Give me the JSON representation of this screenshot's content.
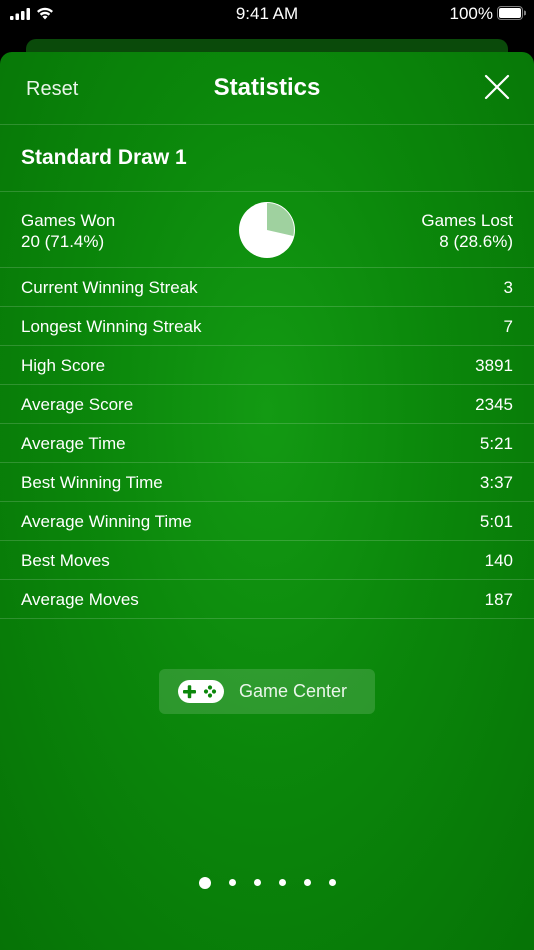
{
  "status_bar": {
    "time": "9:41 AM",
    "battery_percent": "100%",
    "icons": [
      "signal-icon",
      "wifi-icon",
      "battery-icon"
    ]
  },
  "nav": {
    "reset_label": "Reset",
    "title": "Statistics",
    "close_icon": "close-icon"
  },
  "section": {
    "title": "Standard Draw 1"
  },
  "summary": {
    "won_label": "Games Won",
    "won_value": "20 (71.4%)",
    "lost_label": "Games Lost",
    "lost_value": "8 (28.6%)",
    "won_fraction": 0.714,
    "won_color": "#ffffff",
    "lost_color": "#9fd19f"
  },
  "stats": [
    {
      "label": "Current Winning Streak",
      "value": "3"
    },
    {
      "label": "Longest Winning Streak",
      "value": "7"
    },
    {
      "label": "High Score",
      "value": "3891"
    },
    {
      "label": "Average Score",
      "value": "2345"
    },
    {
      "label": "Average Time",
      "value": "5:21"
    },
    {
      "label": "Best Winning Time",
      "value": "3:37"
    },
    {
      "label": "Average Winning Time",
      "value": "5:01"
    },
    {
      "label": "Best Moves",
      "value": "140"
    },
    {
      "label": "Average Moves",
      "value": "187"
    }
  ],
  "game_center": {
    "label": "Game Center",
    "icon": "game-controller-icon"
  },
  "pagination": {
    "total": 6,
    "current": 1
  },
  "colors": {
    "sheet_green": "#0b870b",
    "text": "#ffffff"
  }
}
